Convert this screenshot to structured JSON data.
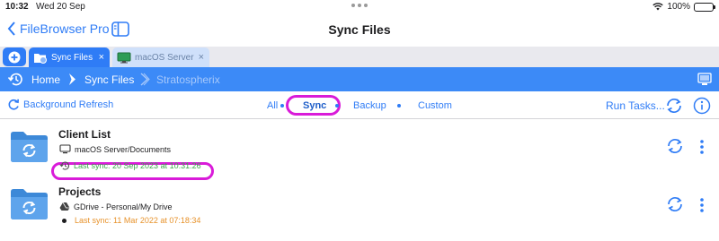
{
  "status_bar": {
    "time": "10:32",
    "date": "Wed 20 Sep",
    "battery": "100%",
    "battery_level": 1.0
  },
  "nav": {
    "back_label": "FileBrowser Pro",
    "title": "Sync Files"
  },
  "tabs": [
    {
      "label": "Sync Files",
      "close": "×",
      "icon": "sync-files-icon"
    },
    {
      "label": "macOS Server",
      "close": "×",
      "icon": "monitor-icon"
    }
  ],
  "breadcrumb": {
    "items": [
      "Home",
      "Sync Files",
      "Stratospherix"
    ]
  },
  "toolbar": {
    "background_refresh": "Background Refresh",
    "filters": [
      "All",
      "Sync",
      "Backup",
      "Custom"
    ],
    "selected_filter": "Sync",
    "run_tasks": "Run Tasks..."
  },
  "tasks": [
    {
      "title": "Client List",
      "location": "macOS Server/Documents",
      "location_icon": "monitor-icon",
      "last_sync": "Last sync: 20 Sep 2023 at 10:31:26",
      "status_color": "#3aa84a"
    },
    {
      "title": "Projects",
      "location": "GDrive - Personal/My Drive",
      "location_icon": "google-drive-icon",
      "last_sync": "Last sync: 11 Mar 2022 at 07:18:34",
      "status_color": "#e7922b"
    }
  ],
  "colors": {
    "accent": "#2f7cf6",
    "breadcrumb_bg": "#3c8af7",
    "highlight": "#d91bd9"
  }
}
